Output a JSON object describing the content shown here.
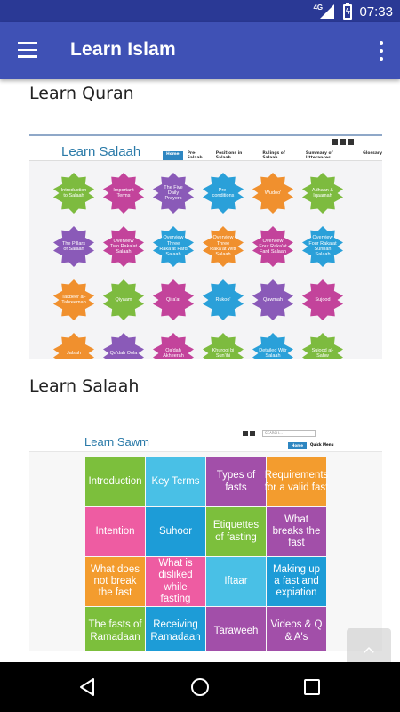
{
  "status_bar": {
    "network": "4G",
    "time": "07:33"
  },
  "app_bar": {
    "title": "Learn Islam"
  },
  "sections": [
    {
      "title": "Learn Quran"
    },
    {
      "title": "Learn Salaah"
    }
  ],
  "salaah_preview": {
    "logo": "Learn Salaah",
    "nav": [
      "Home",
      "Pre-Salaah",
      "Positions in Salaah",
      "Rulings of Salaah",
      "Summary of Utterances",
      "Glossary"
    ],
    "stars": [
      {
        "label": "Introduction to Salaah",
        "color": "#7dbb3f"
      },
      {
        "label": "Important Terms",
        "color": "#c3439b"
      },
      {
        "label": "The Five Daily Prayers",
        "color": "#8a5ab8"
      },
      {
        "label": "Pre-conditions",
        "color": "#2aa0d9"
      },
      {
        "label": "Wudoo'",
        "color": "#f0902e"
      },
      {
        "label": "Adhaan & Iqaamah",
        "color": "#7dbb3f"
      },
      {
        "label": "The Pillars of Salaah",
        "color": "#8a5ab8"
      },
      {
        "label": "Overview Two Raka'at Salaah",
        "color": "#c3439b"
      },
      {
        "label": "Overview Three Raka'at Fard Salaah",
        "color": "#2aa0d9"
      },
      {
        "label": "Overview Three Raka'at Witr Salaah",
        "color": "#f0902e"
      },
      {
        "label": "Overview Four Raka'at Fard Salaah",
        "color": "#c3439b"
      },
      {
        "label": "Overview Four Raka'at Sunnah Salaah",
        "color": "#2aa0d9"
      },
      {
        "label": "Takbeer al-Tahreemah",
        "color": "#f0902e"
      },
      {
        "label": "Qiyaam",
        "color": "#7dbb3f"
      },
      {
        "label": "Qira'at",
        "color": "#c3439b"
      },
      {
        "label": "Rukoo'",
        "color": "#2aa0d9"
      },
      {
        "label": "Qawmah",
        "color": "#8a5ab8"
      },
      {
        "label": "Sujood",
        "color": "#c3439b"
      },
      {
        "label": "Jalsah",
        "color": "#f0902e"
      },
      {
        "label": "Qa'dah Oola",
        "color": "#8a5ab8"
      },
      {
        "label": "Qa'dah Akheerah",
        "color": "#c3439b"
      },
      {
        "label": "Khurooj bi Sun'ihi",
        "color": "#7dbb3f"
      },
      {
        "label": "Detailed Witr Salaah",
        "color": "#2aa0d9"
      },
      {
        "label": "Sujood al-Sahw",
        "color": "#7dbb3f"
      }
    ]
  },
  "sawm_preview": {
    "logo": "Learn Sawm",
    "search_placeholder": "SEARCH...",
    "nav": [
      "Home",
      "Quick Menu"
    ],
    "tiles": [
      {
        "label": "Introduction",
        "color": "#7cbf3c"
      },
      {
        "label": "Key Terms",
        "color": "#49c0e6"
      },
      {
        "label": "Types of fasts",
        "color": "#a24fa9"
      },
      {
        "label": "Requirements for a valid fast",
        "color": "#f39c2e"
      },
      {
        "label": "Intention",
        "color": "#ee5ca2"
      },
      {
        "label": "Suhoor",
        "color": "#1d9cd7"
      },
      {
        "label": "Etiquettes of fasting",
        "color": "#7cbf3c"
      },
      {
        "label": "What breaks the fast",
        "color": "#a24fa9"
      },
      {
        "label": "What does not break the fast",
        "color": "#f39c2e"
      },
      {
        "label": "What is disliked while fasting",
        "color": "#ee5ca2"
      },
      {
        "label": "Iftaar",
        "color": "#49c0e6"
      },
      {
        "label": "Making up a fast and expiation",
        "color": "#1d9cd7"
      },
      {
        "label": "The fasts of Ramadaan",
        "color": "#7cbf3c"
      },
      {
        "label": "Receiving Ramadaan",
        "color": "#1d9cd7"
      },
      {
        "label": "Taraweeh",
        "color": "#a24fa9"
      },
      {
        "label": "Videos & Q & A's",
        "color": "#a24fa9"
      }
    ]
  },
  "icons": {
    "menu": "hamburger-menu-icon",
    "overflow": "more-vert-icon",
    "scroll_top": "chevron-up-icon",
    "back": "back-triangle-icon",
    "home": "home-circle-icon",
    "recents": "recents-square-icon"
  },
  "colors": {
    "app_bar": "#3f51b5",
    "status_bar": "#2a3995"
  }
}
